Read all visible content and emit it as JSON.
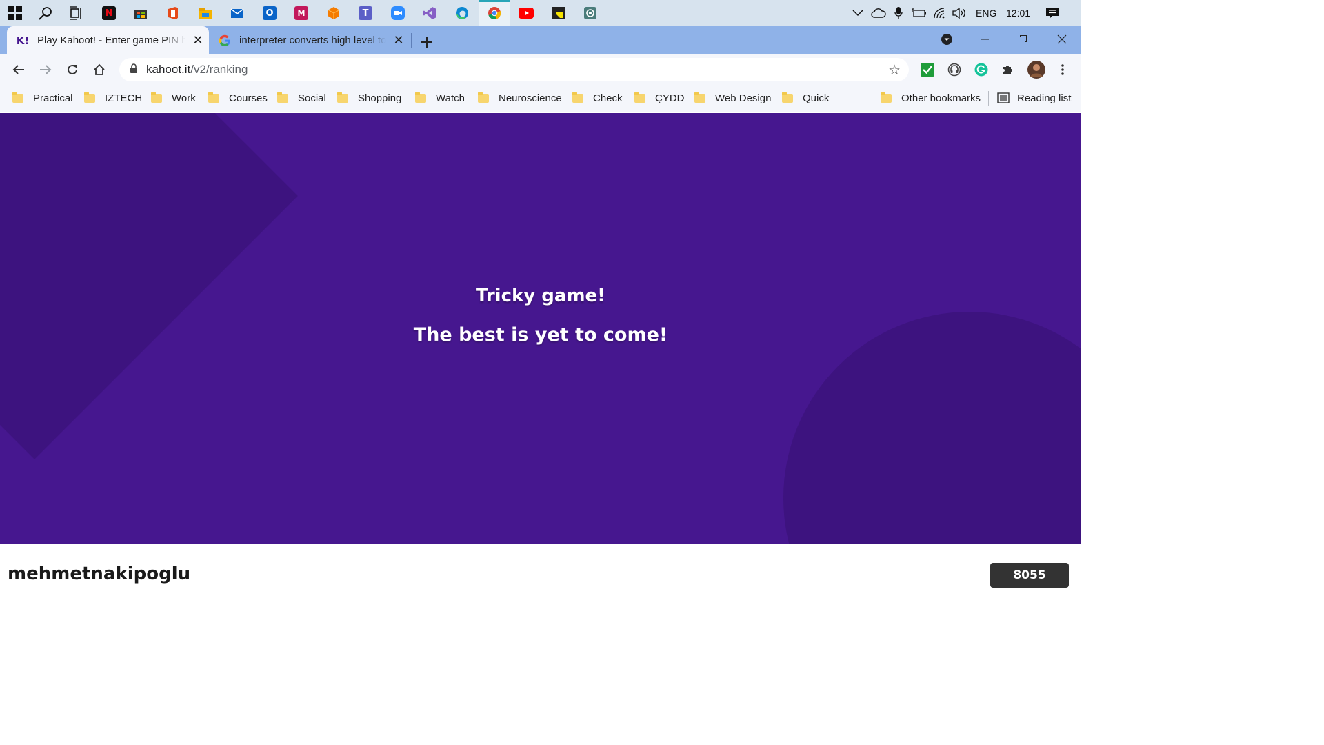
{
  "taskbar": {
    "apps": [
      {
        "icon": "windows-start-icon"
      },
      {
        "icon": "search-icon"
      },
      {
        "icon": "task-view-icon"
      },
      {
        "icon": "netflix-icon",
        "color": "#e50914"
      },
      {
        "icon": "microsoft-store-icon",
        "color": "#333333"
      },
      {
        "icon": "office-icon",
        "color": "#e64a19"
      },
      {
        "icon": "file-explorer-icon",
        "color": "#f4b400"
      },
      {
        "icon": "mail-icon",
        "color": "#0a64c8"
      },
      {
        "icon": "outlook-icon",
        "color": "#0a64c8"
      },
      {
        "icon": "mendeley-icon",
        "color": "#c2185b"
      },
      {
        "icon": "package-icon",
        "color": "#f57c00"
      },
      {
        "icon": "teams-icon",
        "color": "#5b5fc7"
      },
      {
        "icon": "zoom-icon",
        "color": "#2d8cff"
      },
      {
        "icon": "visual-studio-icon",
        "color": "#865fc5"
      },
      {
        "icon": "edge-icon",
        "color": "#0c88d1"
      },
      {
        "icon": "chrome-icon",
        "color": "#e9f1f7"
      },
      {
        "icon": "youtube-icon",
        "color": "#ff0000"
      },
      {
        "icon": "sticky-notes-icon",
        "color": "#222222"
      },
      {
        "icon": "screen-capture-icon",
        "color": "#4a7c7a"
      }
    ],
    "tray": {
      "language": "ENG",
      "time": "12:01"
    }
  },
  "browser": {
    "tabs": [
      {
        "title": "Play Kahoot! - Enter game PIN here!",
        "active": true
      },
      {
        "title": "interpreter converts high level to",
        "active": false
      }
    ],
    "url": {
      "host": "kahoot.it",
      "path": "/v2/ranking"
    },
    "bookmarks": [
      "Practical",
      "IZTECH",
      "Work",
      "Courses",
      "Social",
      "Shopping",
      "Watch",
      "Neuroscience",
      "Check",
      "ÇYDD",
      "Web Design",
      "Quick"
    ],
    "other_bookmarks": "Other bookmarks",
    "reading_list": "Reading list"
  },
  "kahoot": {
    "message_line1": "Tricky game!",
    "message_line2": "The best is yet to come!",
    "player_name": "mehmetnakipoglu",
    "score": "8055",
    "colors": {
      "background": "#46178f",
      "shape": "#3d137f",
      "score_badge": "#333333"
    }
  }
}
